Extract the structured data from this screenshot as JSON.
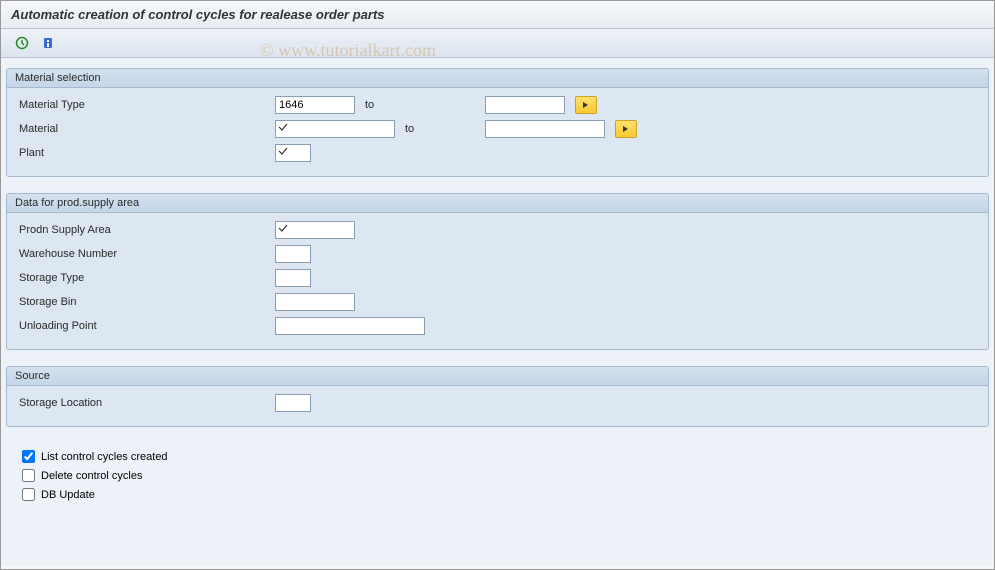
{
  "page_title": "Automatic creation of control cycles for realease order parts",
  "watermark": "© www.tutorialkart.com",
  "group1": {
    "title": "Material selection",
    "material_type_label": "Material Type",
    "material_type_value": "1646",
    "material_type_to": "",
    "material_label": "Material",
    "material_value": "",
    "material_to": "",
    "plant_label": "Plant",
    "plant_value": "",
    "to_label": "to"
  },
  "group2": {
    "title": "Data for prod.supply area",
    "supply_area_label": "Prodn Supply Area",
    "supply_area_value": "",
    "warehouse_label": "Warehouse Number",
    "warehouse_value": "",
    "storage_type_label": "Storage Type",
    "storage_type_value": "",
    "storage_bin_label": "Storage Bin",
    "storage_bin_value": "",
    "unloading_label": "Unloading Point",
    "unloading_value": ""
  },
  "group3": {
    "title": "Source",
    "storage_location_label": "Storage Location",
    "storage_location_value": ""
  },
  "checks": {
    "list_label": "List control cycles created",
    "list_checked": true,
    "delete_label": "Delete control cycles",
    "delete_checked": false,
    "db_label": "DB Update",
    "db_checked": false
  }
}
